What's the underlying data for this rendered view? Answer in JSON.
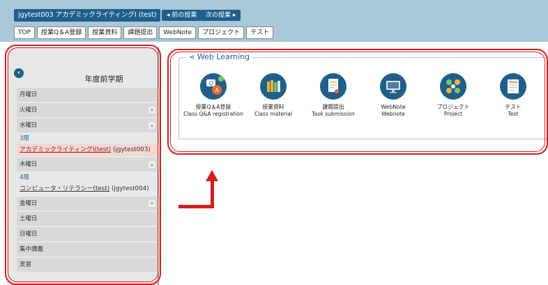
{
  "header": {
    "course_title": "jgytest003 アカデミックライティングⅠ (test)",
    "prev_label": "◂ 前の授業",
    "next_label": "次の授業 ▸",
    "tabs": [
      "TOP",
      "授業Q＆A登録",
      "授業資料",
      "課題提出",
      "WebNote",
      "プロジェクト",
      "テスト"
    ]
  },
  "sidebar": {
    "semester": "年度前学期",
    "days": {
      "mon": "月曜日",
      "tue": "火曜日",
      "wed": "水曜日",
      "thu": "木曜日",
      "fri": "金曜日",
      "sat": "土曜日",
      "sun": "日曜日",
      "intensive": "集中講義",
      "practicum": "実習"
    },
    "wed_period": "3限",
    "wed_course_name": "アカデミックライティングⅠ(test)",
    "wed_course_code": "(jgytest003)",
    "thu_period": "4限",
    "thu_course_name": "コンピュータ・リテラシー(test)",
    "thu_course_code": "(jgytest004)"
  },
  "web_learning": {
    "title": "Web Learning",
    "tools": [
      {
        "label": "授業Q＆A登録",
        "sub": "Class Q&A registration",
        "icon": "qa-icon"
      },
      {
        "label": "授業資料",
        "sub": "Class material",
        "icon": "books-icon"
      },
      {
        "label": "課題提出",
        "sub": "Task submission",
        "icon": "task-icon"
      },
      {
        "label": "WebNote",
        "sub": "Webnote",
        "icon": "monitor-icon"
      },
      {
        "label": "プロジェクト",
        "sub": "Project",
        "icon": "project-icon"
      },
      {
        "label": "テスト",
        "sub": "Test",
        "icon": "test-icon"
      }
    ]
  },
  "colors": {
    "brand": "#1f5f8b",
    "highlight": "#d21f1f",
    "header_bg": "#a9c7d8"
  }
}
